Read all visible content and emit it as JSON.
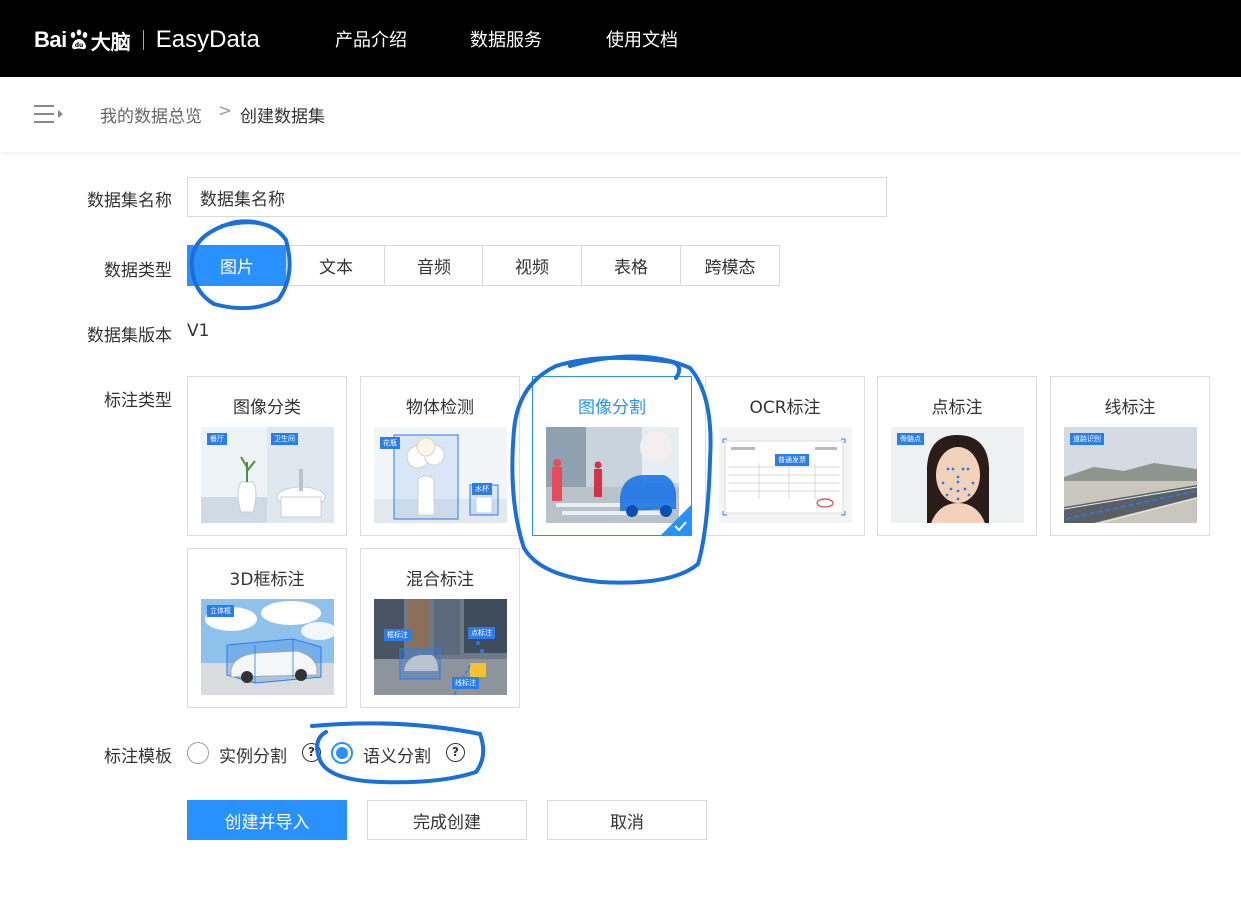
{
  "header": {
    "logo_bai": "Bai",
    "logo_danao": "大脑",
    "logo_product": "EasyData",
    "nav": [
      "产品介绍",
      "数据服务",
      "使用文档"
    ]
  },
  "breadcrumb": {
    "parent": "我的数据总览",
    "separator": ">",
    "current": "创建数据集"
  },
  "form": {
    "name_label": "数据集名称",
    "name_value": "数据集名称",
    "type_label": "数据类型",
    "types": [
      "图片",
      "文本",
      "音频",
      "视频",
      "表格",
      "跨模态"
    ],
    "selected_type": "图片",
    "version_label": "数据集版本",
    "version_value": "V1",
    "annotation_label": "标注类型",
    "annotation_types": [
      {
        "title": "图像分类",
        "tags": [
          "餐厅",
          "卫生间"
        ]
      },
      {
        "title": "物体检测",
        "tags": [
          "花瓶",
          "水杯"
        ]
      },
      {
        "title": "图像分割",
        "tags": []
      },
      {
        "title": "OCR标注",
        "tags": [
          "普通发票"
        ]
      },
      {
        "title": "点标注",
        "tags": [
          "骨骼点"
        ]
      },
      {
        "title": "线标注",
        "tags": [
          "道路识别"
        ]
      },
      {
        "title": "3D框标注",
        "tags": [
          "立体框"
        ]
      },
      {
        "title": "混合标注",
        "tags": [
          "框标注",
          "点标注",
          "线标注"
        ]
      }
    ],
    "selected_annotation": "图像分割",
    "template_label": "标注模板",
    "templates": [
      "实例分割",
      "语义分割"
    ],
    "selected_template": "语义分割",
    "help_glyph": "?"
  },
  "actions": {
    "create_import": "创建并导入",
    "finish": "完成创建",
    "cancel": "取消"
  },
  "colors": {
    "accent": "#2891ff",
    "header_bg": "#000000",
    "annotation_pen": "#1a6fd8"
  }
}
